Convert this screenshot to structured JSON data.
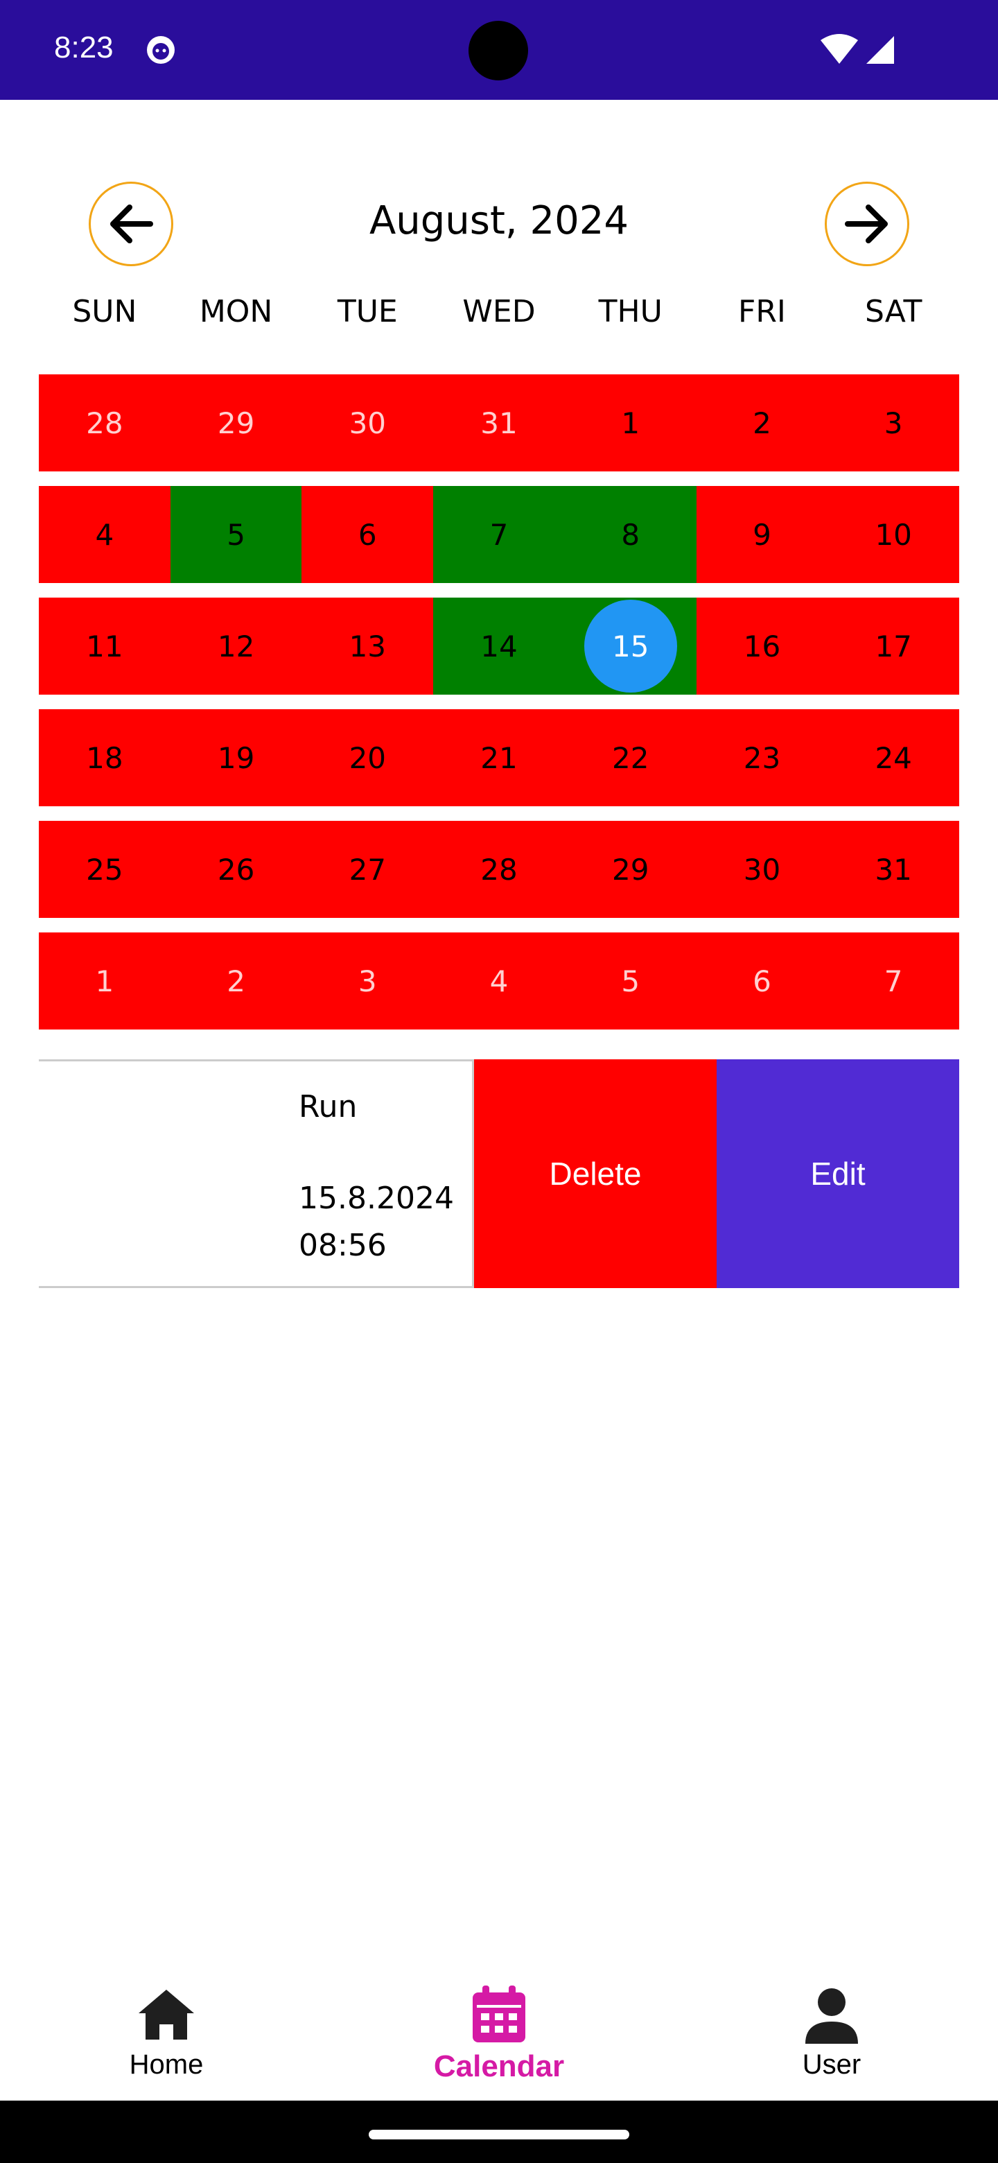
{
  "status_bar": {
    "time": "8:23"
  },
  "header": {
    "month_title": "August, 2024"
  },
  "weekdays": [
    "SUN",
    "MON",
    "TUE",
    "WED",
    "THU",
    "FRI",
    "SAT"
  ],
  "calendar": {
    "weeks": [
      [
        {
          "d": "28",
          "s": "other"
        },
        {
          "d": "29",
          "s": "other"
        },
        {
          "d": "30",
          "s": "other"
        },
        {
          "d": "31",
          "s": "other"
        },
        {
          "d": "1",
          "s": "red"
        },
        {
          "d": "2",
          "s": "red"
        },
        {
          "d": "3",
          "s": "red"
        }
      ],
      [
        {
          "d": "4",
          "s": "red"
        },
        {
          "d": "5",
          "s": "green"
        },
        {
          "d": "6",
          "s": "red"
        },
        {
          "d": "7",
          "s": "green"
        },
        {
          "d": "8",
          "s": "green"
        },
        {
          "d": "9",
          "s": "red"
        },
        {
          "d": "10",
          "s": "red"
        }
      ],
      [
        {
          "d": "11",
          "s": "red"
        },
        {
          "d": "12",
          "s": "red"
        },
        {
          "d": "13",
          "s": "red"
        },
        {
          "d": "14",
          "s": "green"
        },
        {
          "d": "15",
          "s": "today"
        },
        {
          "d": "16",
          "s": "red"
        },
        {
          "d": "17",
          "s": "red"
        }
      ],
      [
        {
          "d": "18",
          "s": "red"
        },
        {
          "d": "19",
          "s": "red"
        },
        {
          "d": "20",
          "s": "red"
        },
        {
          "d": "21",
          "s": "red"
        },
        {
          "d": "22",
          "s": "red"
        },
        {
          "d": "23",
          "s": "red"
        },
        {
          "d": "24",
          "s": "red"
        }
      ],
      [
        {
          "d": "25",
          "s": "red"
        },
        {
          "d": "26",
          "s": "red"
        },
        {
          "d": "27",
          "s": "red"
        },
        {
          "d": "28",
          "s": "red"
        },
        {
          "d": "29",
          "s": "red"
        },
        {
          "d": "30",
          "s": "red"
        },
        {
          "d": "31",
          "s": "red"
        }
      ],
      [
        {
          "d": "1",
          "s": "other"
        },
        {
          "d": "2",
          "s": "other"
        },
        {
          "d": "3",
          "s": "other"
        },
        {
          "d": "4",
          "s": "other"
        },
        {
          "d": "5",
          "s": "other"
        },
        {
          "d": "6",
          "s": "other"
        },
        {
          "d": "7",
          "s": "other"
        }
      ]
    ]
  },
  "event": {
    "name": "Run",
    "date": "15.8.2024",
    "time": "08:56",
    "delete_label": "Delete",
    "edit_label": "Edit"
  },
  "tabs": {
    "home_label": "Home",
    "calendar_label": "Calendar",
    "user_label": "User"
  },
  "colors": {
    "status_bar": "#2a0d9b",
    "day_default": "#ff0000",
    "day_marked": "#008000",
    "today": "#2196f3",
    "nav_border": "#f2a516",
    "edit": "#512bd4",
    "tab_active": "#d51aa5"
  },
  "icons": {
    "prev": "arrow-left-icon",
    "next": "arrow-right-icon",
    "home": "home-icon",
    "calendar": "calendar-icon",
    "user": "user-icon"
  }
}
